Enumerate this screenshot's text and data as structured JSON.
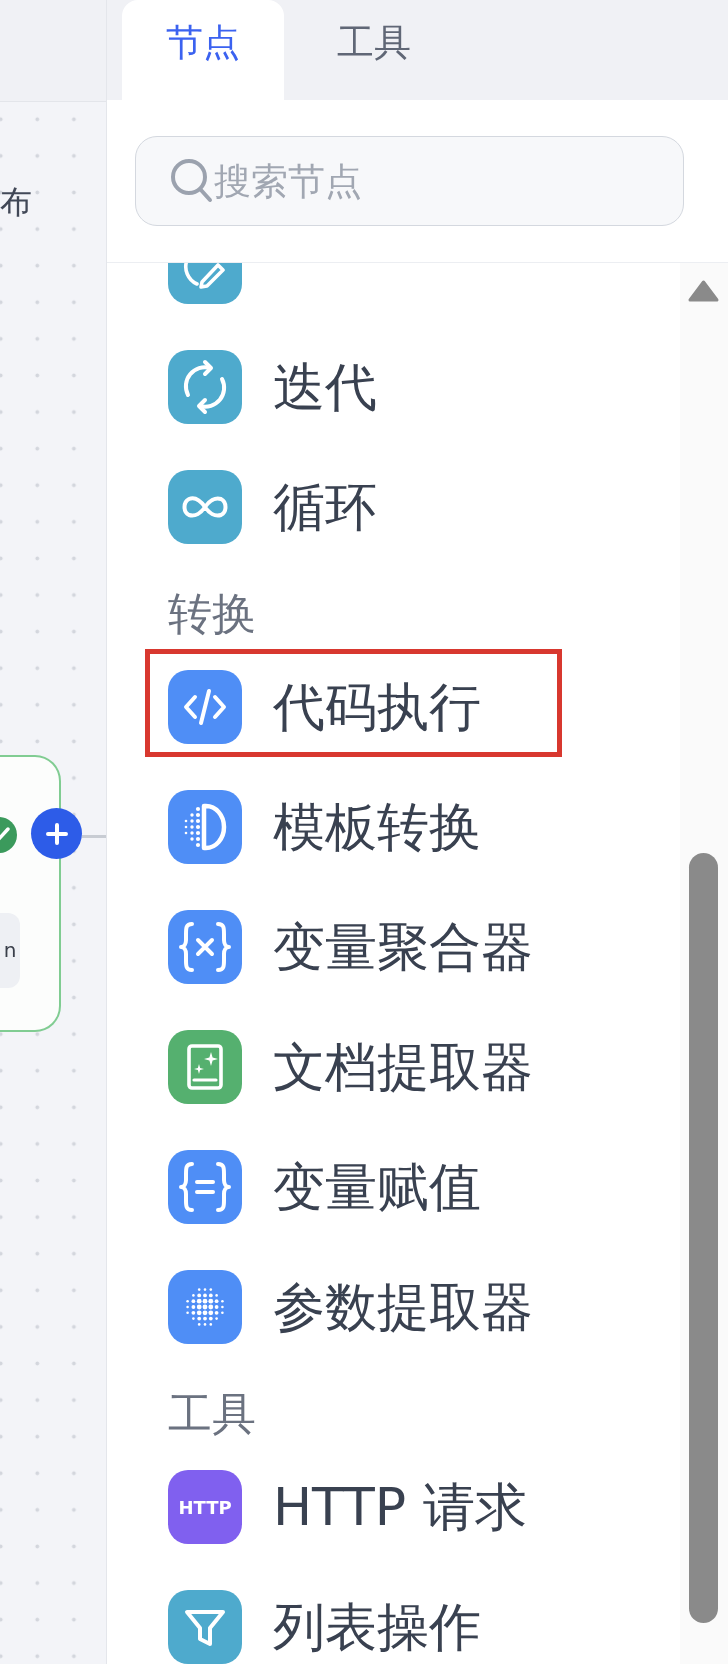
{
  "canvas": {
    "label": "布",
    "node": {
      "tag": "n"
    }
  },
  "tabs": [
    {
      "label": "节点",
      "selected": true
    },
    {
      "label": "工具",
      "selected": false
    }
  ],
  "search": {
    "placeholder": "搜索节点"
  },
  "node_list": {
    "partial_item": {
      "kind": "pen",
      "color": "#4eaacd"
    },
    "sections": [
      {
        "items": [
          {
            "label": "迭代",
            "kind": "iteration",
            "color": "#4eaacd",
            "highlighted": false
          },
          {
            "label": "循环",
            "kind": "loop",
            "color": "#4eaacd",
            "highlighted": false
          }
        ]
      },
      {
        "title": "转换",
        "items": [
          {
            "label": "代码执行",
            "kind": "code",
            "color": "#4f8ef6",
            "highlighted": true
          },
          {
            "label": "模板转换",
            "kind": "template",
            "color": "#4f8ef6",
            "highlighted": false
          },
          {
            "label": "变量聚合器",
            "kind": "aggregator",
            "color": "#4f8ef6",
            "highlighted": false
          },
          {
            "label": "文档提取器",
            "kind": "document",
            "color": "#55b06f",
            "highlighted": false
          },
          {
            "label": "变量赋值",
            "kind": "assigner",
            "color": "#4f8ef6",
            "highlighted": false
          },
          {
            "label": "参数提取器",
            "kind": "parameter",
            "color": "#4f8ef6",
            "highlighted": false
          }
        ]
      },
      {
        "title": "工具",
        "items": [
          {
            "label": "HTTP 请求",
            "kind": "http",
            "icon_text": "HTTP",
            "color": "#8060ef",
            "highlighted": false
          },
          {
            "label": "列表操作",
            "kind": "list",
            "color": "#4eaacd",
            "highlighted": false
          }
        ]
      }
    ]
  }
}
